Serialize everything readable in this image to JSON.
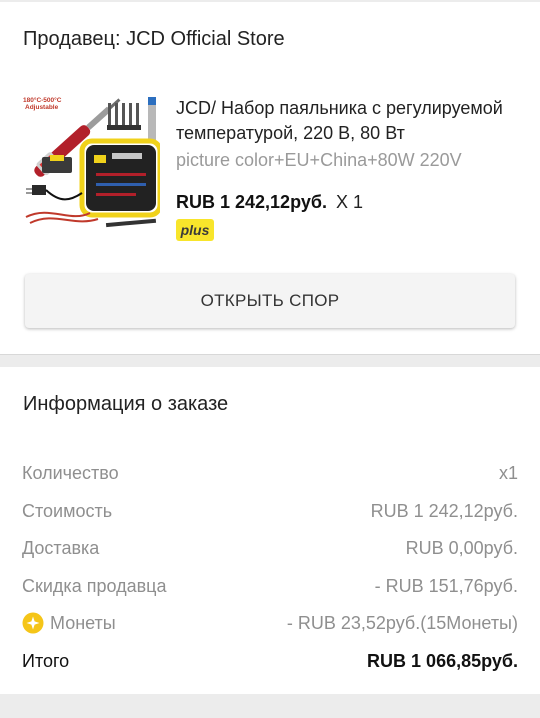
{
  "seller": {
    "title": "Продавец: JCD Official Store"
  },
  "product": {
    "image_icon": "soldering-kit-photo",
    "image_caption": "180°C-500°C Adjustable",
    "name": "JCD/ Набор паяльника с регулируемой температурой, 220 В, 80 Вт",
    "variant": "picture color+EU+China+80W 220V",
    "price": "RUB 1 242,12руб.",
    "quantity": "X 1",
    "plus_badge": "plus"
  },
  "dispute_button": {
    "label": "ОТКРЫТЬ СПОР"
  },
  "order_info": {
    "title": "Информация о заказе",
    "rows": [
      {
        "label": "Количество",
        "value": "x1"
      },
      {
        "label": "Стоимость",
        "value": "RUB 1 242,12руб."
      },
      {
        "label": "Доставка",
        "value": "RUB 0,00руб."
      },
      {
        "label": "Скидка продавца",
        "value": "- RUB 151,76руб."
      },
      {
        "label": "Монеты",
        "value": "- RUB 23,52руб.(15Монеты)",
        "icon": "coin-icon"
      }
    ],
    "total": {
      "label": "Итого",
      "value": "RUB 1 066,85руб."
    }
  },
  "colors": {
    "accent_yellow": "#f8e52b",
    "coin_gold": "#f5c518",
    "muted_text": "#8f8f8f",
    "page_background": "#ececec"
  }
}
